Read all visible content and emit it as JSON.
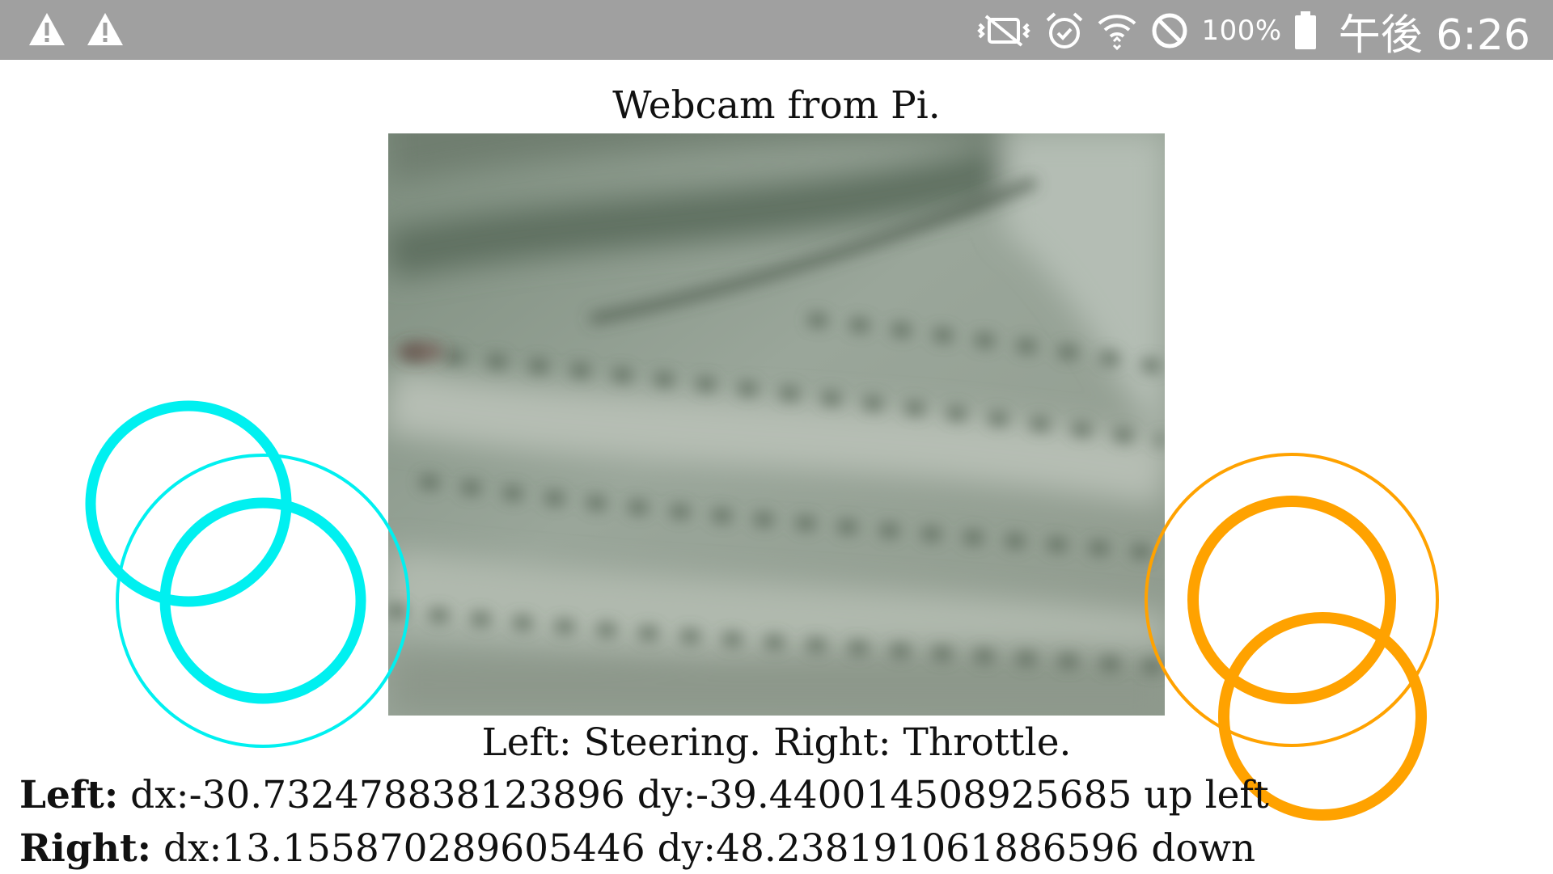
{
  "status_bar": {
    "left_icons": [
      "warning-icon",
      "warning-icon"
    ],
    "right_icons": [
      "vibrate-mute-icon",
      "alarm-icon",
      "wifi-icon",
      "do-not-disturb-icon",
      "battery-icon"
    ],
    "battery_percent": "100%",
    "time": "午後 6:26"
  },
  "page": {
    "title": "Webcam from Pi.",
    "caption": "Left: Steering. Right: Throttle."
  },
  "readouts": {
    "left_label": "Left:",
    "left_value": " dx:-30.732478838123896 dy:-39.440014508925685 up left",
    "right_label": "Right:",
    "right_value": " dx:13.155870289605446 dy:48.238191061886596 down"
  },
  "joysticks": {
    "left_color": "#00f0f0",
    "right_color": "#ffa200"
  }
}
